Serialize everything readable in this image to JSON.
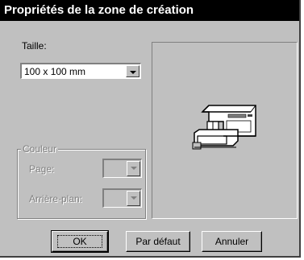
{
  "dialog": {
    "title": "Propriétés de la zone de création"
  },
  "size": {
    "label": "Taille:",
    "value": "100 x 100 mm"
  },
  "color_group": {
    "label": "Couleur",
    "page_label": "Page:",
    "background_label": "Arrière-plan:"
  },
  "preview": {
    "icon": "sewing-machine-icon"
  },
  "buttons": {
    "ok": "OK",
    "default": "Par défaut",
    "cancel": "Annuler"
  }
}
